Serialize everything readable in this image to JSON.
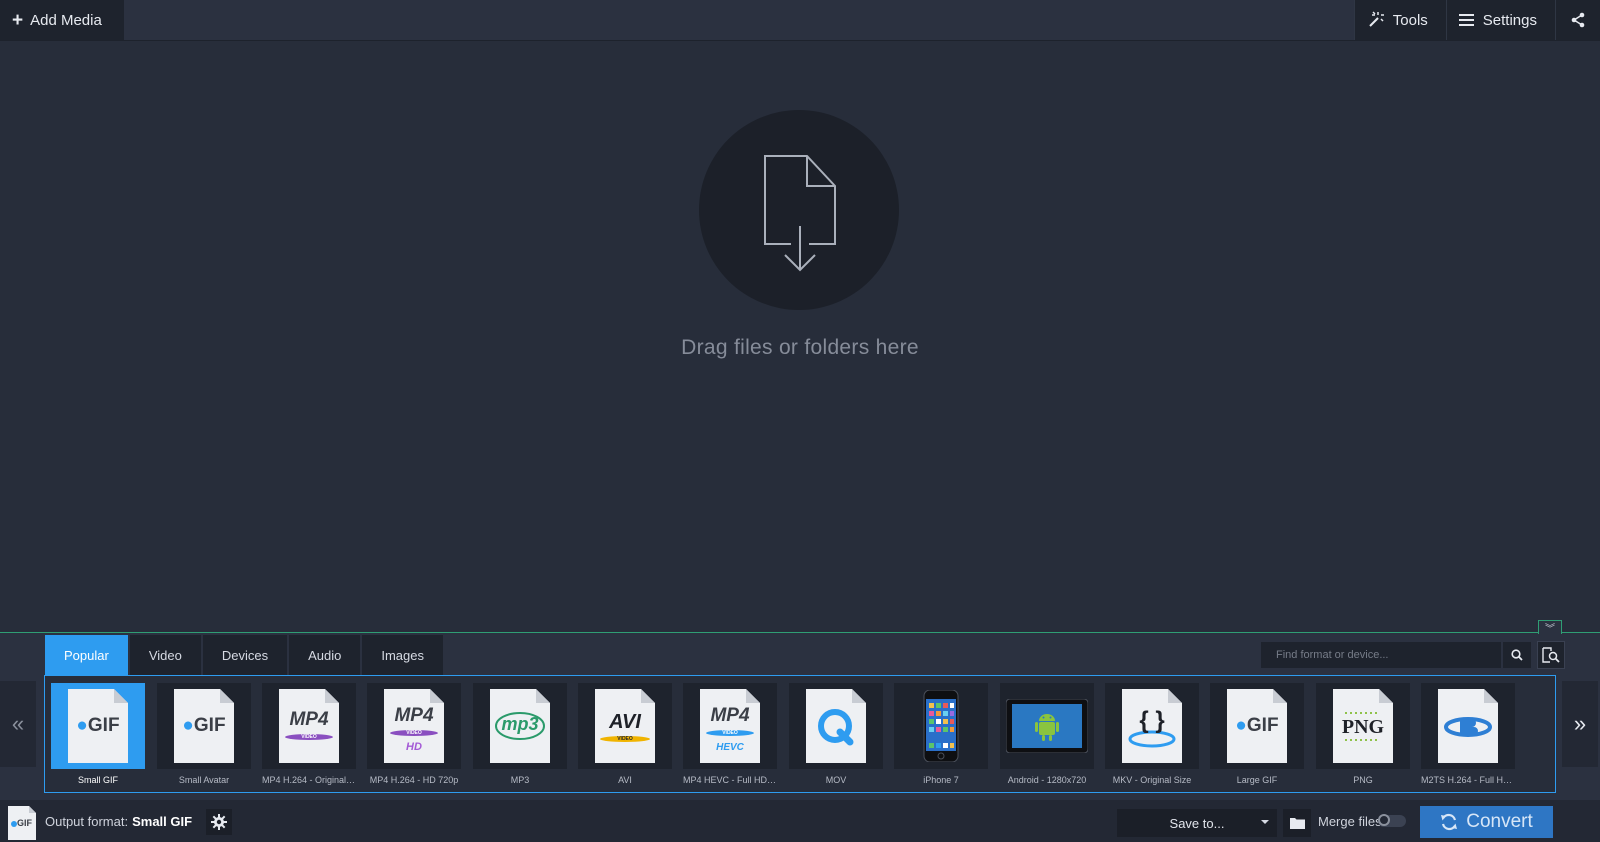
{
  "topbar": {
    "add_media_label": "Add Media",
    "tools_label": "Tools",
    "settings_label": "Settings"
  },
  "dropzone": {
    "text": "Drag files or folders here"
  },
  "tabs": [
    "Popular",
    "Video",
    "Devices",
    "Audio",
    "Images"
  ],
  "active_tab": "Popular",
  "search": {
    "placeholder": "Find format or device..."
  },
  "formats": [
    {
      "label": "Small GIF",
      "icon": "gif-icon",
      "badge": "GIF",
      "selected": true
    },
    {
      "label": "Small Avatar",
      "icon": "gif-icon",
      "badge": "GIF"
    },
    {
      "label": "MP4 H.264 - Original ...",
      "icon": "mp4-icon",
      "badge": "MP4",
      "sub": "VIDEO"
    },
    {
      "label": "MP4 H.264 - HD 720p",
      "icon": "mp4-hd-icon",
      "badge": "MP4",
      "sub": "VIDEO",
      "tag": "HD"
    },
    {
      "label": "MP3",
      "icon": "mp3-icon",
      "badge": "mp3"
    },
    {
      "label": "AVI",
      "icon": "avi-icon",
      "badge": "AVI",
      "sub": "VIDEO"
    },
    {
      "label": "MP4 HEVC - Full HD 1...",
      "icon": "mp4-hevc-icon",
      "badge": "MP4",
      "sub": "VIDEO",
      "tag": "HEVC"
    },
    {
      "label": "MOV",
      "icon": "quicktime-icon"
    },
    {
      "label": "iPhone 7",
      "icon": "iphone-icon"
    },
    {
      "label": "Android - 1280x720",
      "icon": "android-tablet-icon"
    },
    {
      "label": "MKV - Original Size",
      "icon": "mkv-icon",
      "badge": "{ }"
    },
    {
      "label": "Large GIF",
      "icon": "gif-icon",
      "badge": "GIF"
    },
    {
      "label": "PNG",
      "icon": "png-icon",
      "badge": "PNG"
    },
    {
      "label": "M2TS H.264 - Full HD...",
      "icon": "bluray-icon"
    }
  ],
  "bottombar": {
    "output_prefix": "Output format:",
    "output_value": "Small GIF",
    "output_icon_badge": "GIF",
    "save_to_label": "Save to...",
    "merge_label": "Merge files",
    "convert_label": "Convert"
  },
  "colors": {
    "accent": "#2e9cf0",
    "convert": "#2e76c4",
    "panel_border": "#2f9e74",
    "background": "#272d3a"
  }
}
